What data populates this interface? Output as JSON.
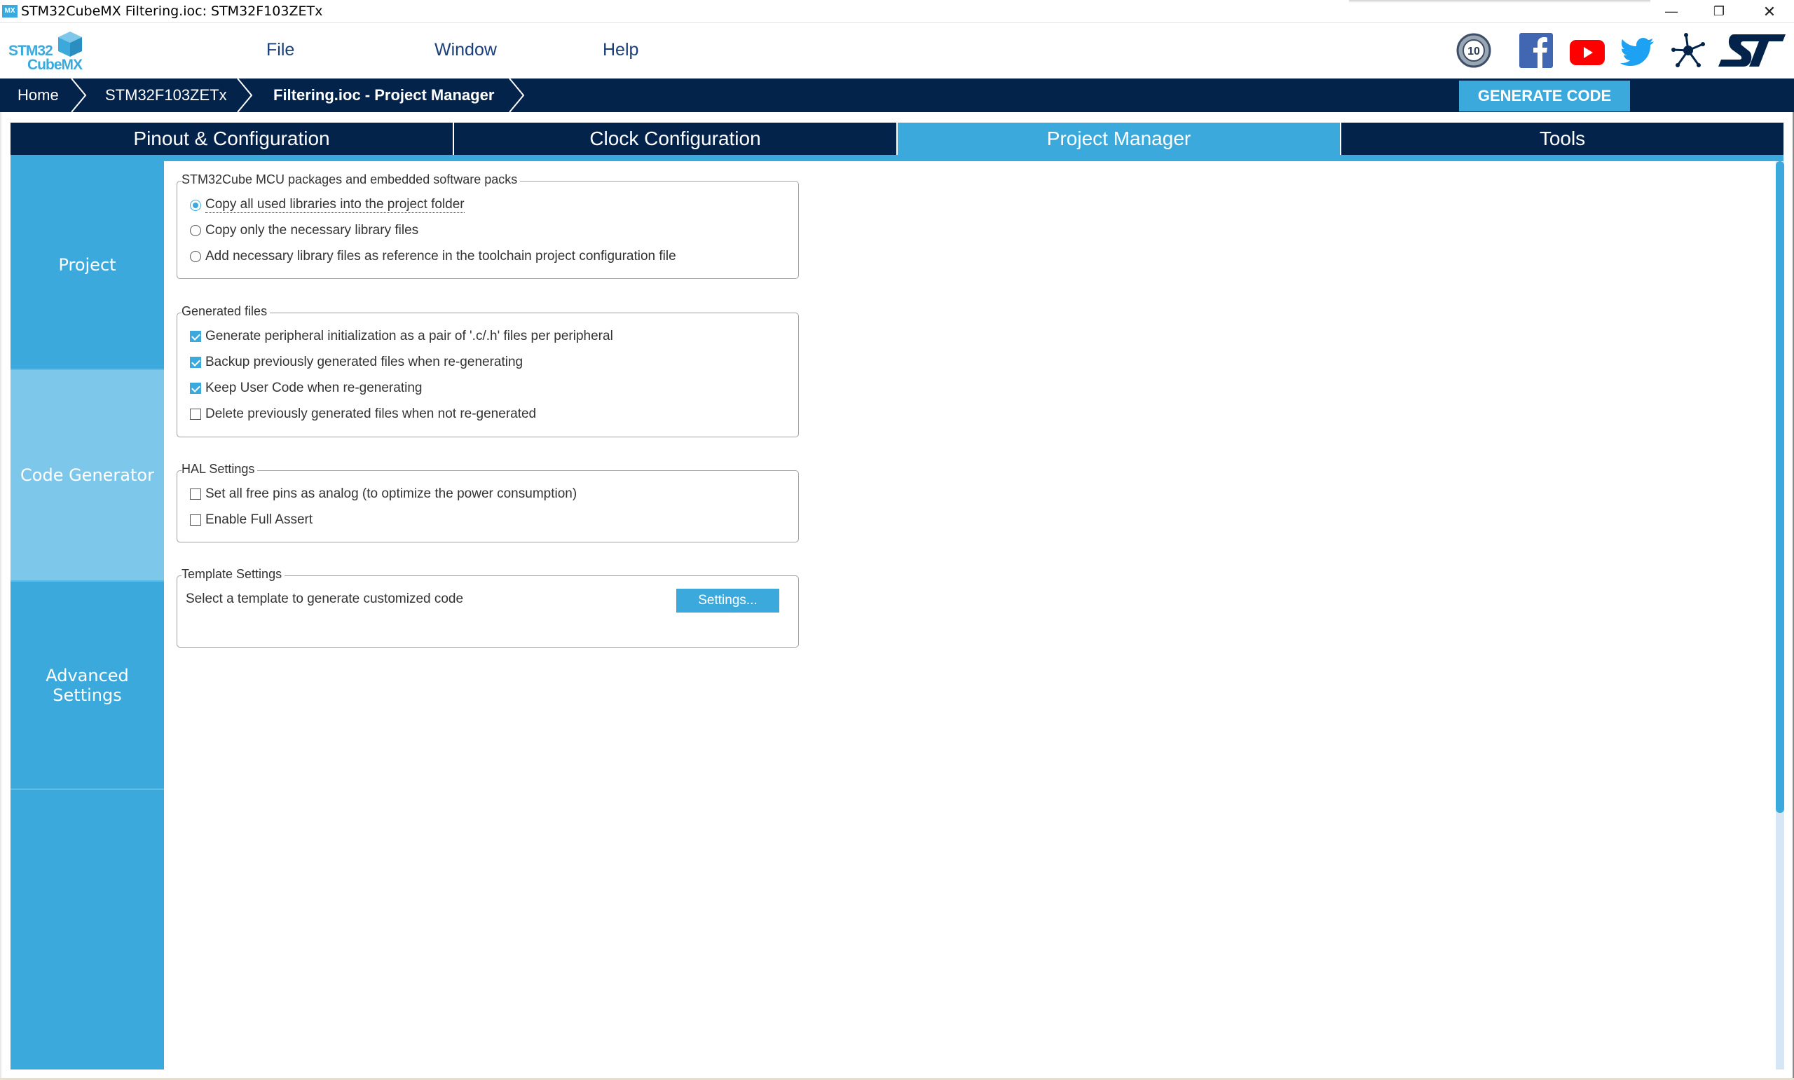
{
  "window": {
    "app_icon": "MX",
    "title": "STM32CubeMX Filtering.ioc: STM32F103ZETx",
    "controls": {
      "minimize": "—",
      "restore": "❐",
      "close": "✕"
    }
  },
  "header": {
    "logo_line1": "STM32",
    "logo_line2": "CubeMX",
    "menu": [
      {
        "label": "File"
      },
      {
        "label": "Window"
      },
      {
        "label": "Help"
      }
    ],
    "icons": [
      "ten-years-badge-icon",
      "facebook-icon",
      "youtube-icon",
      "twitter-icon",
      "network-icon",
      "st-logo-icon"
    ],
    "colors": {
      "facebook": "#4267b2",
      "youtube": "#ff0000",
      "twitter": "#1da1f2",
      "navy": "#03234b"
    }
  },
  "breadcrumb": {
    "items": [
      {
        "label": "Home"
      },
      {
        "label": "STM32F103ZETx"
      },
      {
        "label": "Filtering.ioc - Project Manager"
      }
    ],
    "generate_button": "GENERATE CODE"
  },
  "tabs": [
    {
      "label": "Pinout & Configuration",
      "active": false
    },
    {
      "label": "Clock Configuration",
      "active": false
    },
    {
      "label": "Project Manager",
      "active": true
    },
    {
      "label": "Tools",
      "active": false
    }
  ],
  "sidebar": {
    "items": [
      {
        "label": "Project",
        "active": false
      },
      {
        "label": "Code Generator",
        "active": true
      },
      {
        "label": "Advanced Settings",
        "active": false
      }
    ]
  },
  "groups": {
    "packages": {
      "title": "STM32Cube MCU packages and embedded software packs",
      "options": [
        {
          "label": "Copy all used libraries into the project folder",
          "selected": true
        },
        {
          "label": "Copy only the necessary library files",
          "selected": false
        },
        {
          "label": "Add necessary library files as reference in the toolchain project configuration file",
          "selected": false
        }
      ]
    },
    "generated_files": {
      "title": "Generated files",
      "options": [
        {
          "label": "Generate peripheral initialization as a pair of '.c/.h' files per peripheral",
          "checked": true
        },
        {
          "label": "Backup previously generated files when re-generating",
          "checked": true
        },
        {
          "label": "Keep User Code when re-generating",
          "checked": true
        },
        {
          "label": "Delete previously generated files when not re-generated",
          "checked": false
        }
      ]
    },
    "hal_settings": {
      "title": "HAL Settings",
      "options": [
        {
          "label": "Set all free pins as analog (to optimize the power consumption)",
          "checked": false
        },
        {
          "label": "Enable Full Assert",
          "checked": false
        }
      ]
    },
    "template_settings": {
      "title": "Template Settings",
      "description": "Select a template to generate customized code",
      "button": "Settings..."
    }
  },
  "accent_color": "#3ca9dc"
}
